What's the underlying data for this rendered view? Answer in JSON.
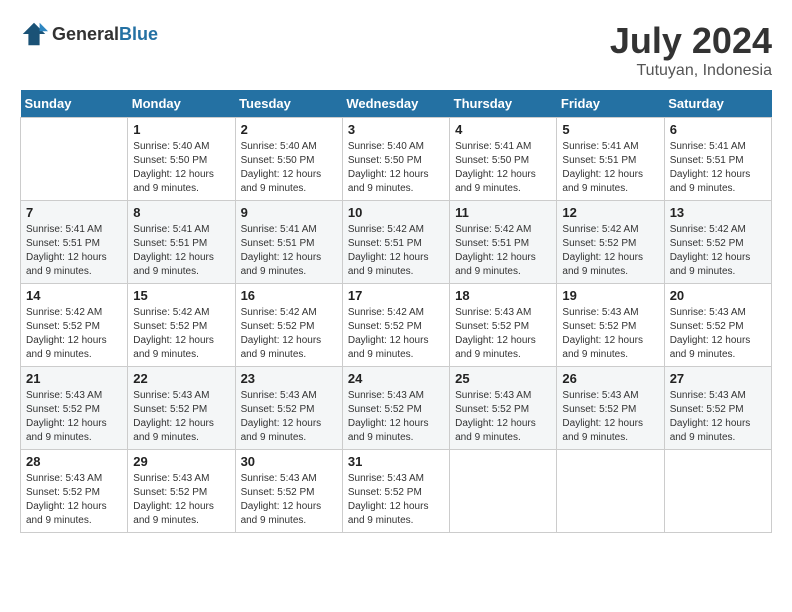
{
  "header": {
    "logo_general": "General",
    "logo_blue": "Blue",
    "month": "July 2024",
    "location": "Tutuyan, Indonesia"
  },
  "days_of_week": [
    "Sunday",
    "Monday",
    "Tuesday",
    "Wednesday",
    "Thursday",
    "Friday",
    "Saturday"
  ],
  "weeks": [
    [
      {
        "day": "",
        "empty": true
      },
      {
        "day": "1",
        "sunrise": "5:40 AM",
        "sunset": "5:50 PM",
        "daylight": "12 hours and 9 minutes."
      },
      {
        "day": "2",
        "sunrise": "5:40 AM",
        "sunset": "5:50 PM",
        "daylight": "12 hours and 9 minutes."
      },
      {
        "day": "3",
        "sunrise": "5:40 AM",
        "sunset": "5:50 PM",
        "daylight": "12 hours and 9 minutes."
      },
      {
        "day": "4",
        "sunrise": "5:41 AM",
        "sunset": "5:50 PM",
        "daylight": "12 hours and 9 minutes."
      },
      {
        "day": "5",
        "sunrise": "5:41 AM",
        "sunset": "5:51 PM",
        "daylight": "12 hours and 9 minutes."
      },
      {
        "day": "6",
        "sunrise": "5:41 AM",
        "sunset": "5:51 PM",
        "daylight": "12 hours and 9 minutes."
      }
    ],
    [
      {
        "day": "7",
        "sunrise": "5:41 AM",
        "sunset": "5:51 PM",
        "daylight": "12 hours and 9 minutes."
      },
      {
        "day": "8",
        "sunrise": "5:41 AM",
        "sunset": "5:51 PM",
        "daylight": "12 hours and 9 minutes."
      },
      {
        "day": "9",
        "sunrise": "5:41 AM",
        "sunset": "5:51 PM",
        "daylight": "12 hours and 9 minutes."
      },
      {
        "day": "10",
        "sunrise": "5:42 AM",
        "sunset": "5:51 PM",
        "daylight": "12 hours and 9 minutes."
      },
      {
        "day": "11",
        "sunrise": "5:42 AM",
        "sunset": "5:51 PM",
        "daylight": "12 hours and 9 minutes."
      },
      {
        "day": "12",
        "sunrise": "5:42 AM",
        "sunset": "5:52 PM",
        "daylight": "12 hours and 9 minutes."
      },
      {
        "day": "13",
        "sunrise": "5:42 AM",
        "sunset": "5:52 PM",
        "daylight": "12 hours and 9 minutes."
      }
    ],
    [
      {
        "day": "14",
        "sunrise": "5:42 AM",
        "sunset": "5:52 PM",
        "daylight": "12 hours and 9 minutes."
      },
      {
        "day": "15",
        "sunrise": "5:42 AM",
        "sunset": "5:52 PM",
        "daylight": "12 hours and 9 minutes."
      },
      {
        "day": "16",
        "sunrise": "5:42 AM",
        "sunset": "5:52 PM",
        "daylight": "12 hours and 9 minutes."
      },
      {
        "day": "17",
        "sunrise": "5:42 AM",
        "sunset": "5:52 PM",
        "daylight": "12 hours and 9 minutes."
      },
      {
        "day": "18",
        "sunrise": "5:43 AM",
        "sunset": "5:52 PM",
        "daylight": "12 hours and 9 minutes."
      },
      {
        "day": "19",
        "sunrise": "5:43 AM",
        "sunset": "5:52 PM",
        "daylight": "12 hours and 9 minutes."
      },
      {
        "day": "20",
        "sunrise": "5:43 AM",
        "sunset": "5:52 PM",
        "daylight": "12 hours and 9 minutes."
      }
    ],
    [
      {
        "day": "21",
        "sunrise": "5:43 AM",
        "sunset": "5:52 PM",
        "daylight": "12 hours and 9 minutes."
      },
      {
        "day": "22",
        "sunrise": "5:43 AM",
        "sunset": "5:52 PM",
        "daylight": "12 hours and 9 minutes."
      },
      {
        "day": "23",
        "sunrise": "5:43 AM",
        "sunset": "5:52 PM",
        "daylight": "12 hours and 9 minutes."
      },
      {
        "day": "24",
        "sunrise": "5:43 AM",
        "sunset": "5:52 PM",
        "daylight": "12 hours and 9 minutes."
      },
      {
        "day": "25",
        "sunrise": "5:43 AM",
        "sunset": "5:52 PM",
        "daylight": "12 hours and 9 minutes."
      },
      {
        "day": "26",
        "sunrise": "5:43 AM",
        "sunset": "5:52 PM",
        "daylight": "12 hours and 9 minutes."
      },
      {
        "day": "27",
        "sunrise": "5:43 AM",
        "sunset": "5:52 PM",
        "daylight": "12 hours and 9 minutes."
      }
    ],
    [
      {
        "day": "28",
        "sunrise": "5:43 AM",
        "sunset": "5:52 PM",
        "daylight": "12 hours and 9 minutes."
      },
      {
        "day": "29",
        "sunrise": "5:43 AM",
        "sunset": "5:52 PM",
        "daylight": "12 hours and 9 minutes."
      },
      {
        "day": "30",
        "sunrise": "5:43 AM",
        "sunset": "5:52 PM",
        "daylight": "12 hours and 9 minutes."
      },
      {
        "day": "31",
        "sunrise": "5:43 AM",
        "sunset": "5:52 PM",
        "daylight": "12 hours and 9 minutes."
      },
      {
        "day": "",
        "empty": true
      },
      {
        "day": "",
        "empty": true
      },
      {
        "day": "",
        "empty": true
      }
    ]
  ],
  "labels": {
    "sunrise": "Sunrise:",
    "sunset": "Sunset:",
    "daylight": "Daylight:"
  }
}
